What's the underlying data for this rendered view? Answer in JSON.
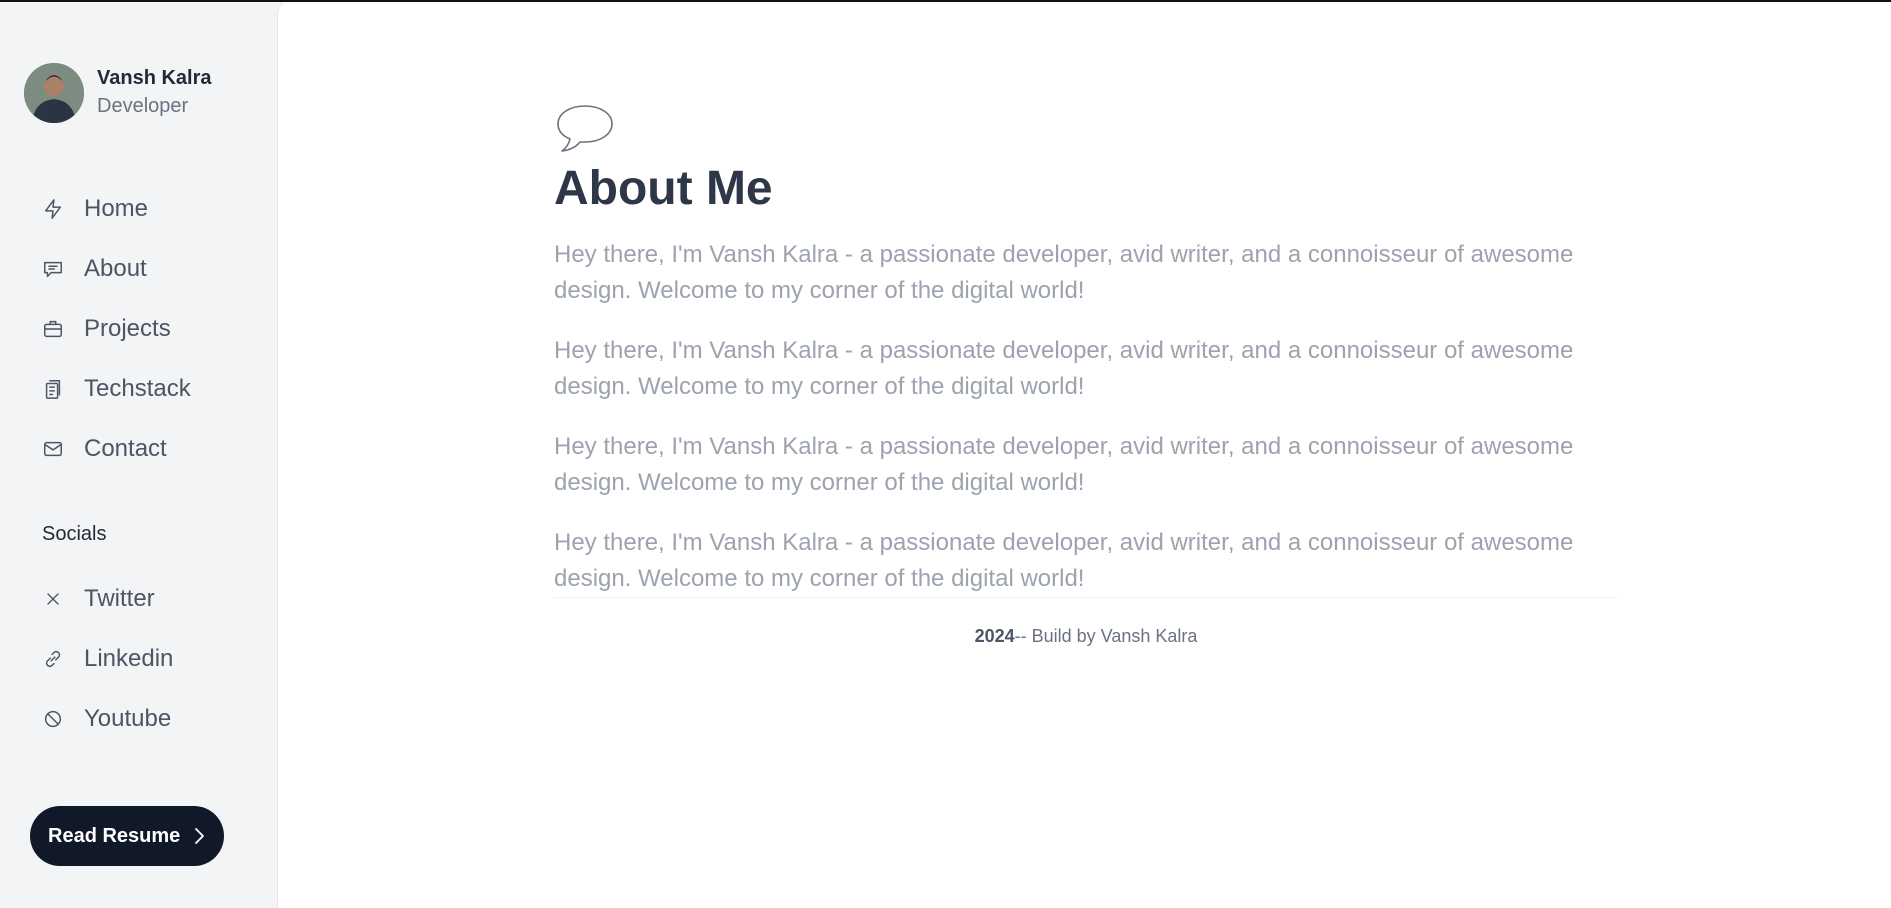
{
  "profile": {
    "name": "Vansh Kalra",
    "role": "Developer"
  },
  "nav": {
    "items": [
      {
        "label": "Home",
        "icon": "bolt-icon"
      },
      {
        "label": "About",
        "icon": "chat-icon"
      },
      {
        "label": "Projects",
        "icon": "briefcase-icon"
      },
      {
        "label": "Techstack",
        "icon": "clipboard-icon"
      },
      {
        "label": "Contact",
        "icon": "mail-icon"
      }
    ]
  },
  "socials": {
    "heading": "Socials",
    "items": [
      {
        "label": "Twitter",
        "icon": "x-icon"
      },
      {
        "label": "Linkedin",
        "icon": "link-icon"
      },
      {
        "label": "Youtube",
        "icon": "ban-icon"
      }
    ]
  },
  "resume_button": {
    "label": "Read Resume"
  },
  "main": {
    "title": "About Me",
    "paragraphs": [
      "Hey there, I'm Vansh Kalra - a passionate developer, avid writer, and a connoisseur of awesome design. Welcome to my corner of the digital world!",
      "Hey there, I'm Vansh Kalra - a passionate developer, avid writer, and a connoisseur of awesome design. Welcome to my corner of the digital world!",
      "Hey there, I'm Vansh Kalra - a passionate developer, avid writer, and a connoisseur of awesome design. Welcome to my corner of the digital world!",
      "Hey there, I'm Vansh Kalra - a passionate developer, avid writer, and a connoisseur of awesome design. Welcome to my corner of the digital world!"
    ]
  },
  "footer": {
    "year": "2024",
    "text": "-- Build by Vansh Kalra"
  },
  "colors": {
    "sidebar_bg": "#f3f4f6",
    "button_bg": "#111827",
    "title": "#2d3748",
    "paragraph": "#9ca3af"
  }
}
